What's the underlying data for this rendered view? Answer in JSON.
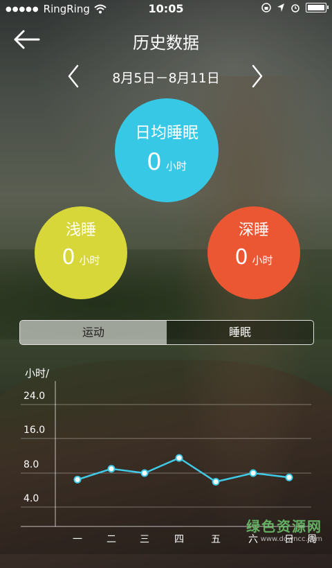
{
  "status_bar": {
    "signal_dots": "●●●●●",
    "carrier": "RingRing",
    "time": "10:05",
    "icons": [
      "wifi-icon",
      "lock-rotation-icon",
      "location-icon",
      "alarm-icon",
      "battery-icon"
    ]
  },
  "header": {
    "title": "历史数据",
    "back_icon": "arrow-left-icon"
  },
  "date_nav": {
    "range": "8月5日－8月11日",
    "prev_icon": "chevron-left-icon",
    "next_icon": "chevron-right-icon"
  },
  "summary": {
    "avg_sleep": {
      "label": "日均睡眠",
      "value": "0",
      "unit": "小时",
      "color": "#37c8e6"
    },
    "light_sleep": {
      "label": "浅睡",
      "value": "0",
      "unit": "小时",
      "color": "#d8d73a"
    },
    "deep_sleep": {
      "label": "深睡",
      "value": "0",
      "unit": "小时",
      "color": "#ec5733"
    }
  },
  "tabs": {
    "sport": "运动",
    "sleep": "睡眠",
    "selected": "sport"
  },
  "chart_data": {
    "type": "line",
    "ylabel": "小时/",
    "xlabel": "周",
    "categories": [
      "一",
      "二",
      "三",
      "四",
      "五",
      "六",
      "日"
    ],
    "y_ticks": [
      "24.0",
      "16.0",
      "8.0",
      "4.0"
    ],
    "series": [
      {
        "values": [
          6.5,
          9.0,
          8.0,
          11.5,
          6.0,
          8.0,
          7.0
        ],
        "color": "#3fcbe8"
      }
    ],
    "ylim": [
      0,
      28
    ],
    "grid": true
  },
  "watermark": {
    "main": "绿色资源网",
    "sub": "www.downcc.com"
  }
}
